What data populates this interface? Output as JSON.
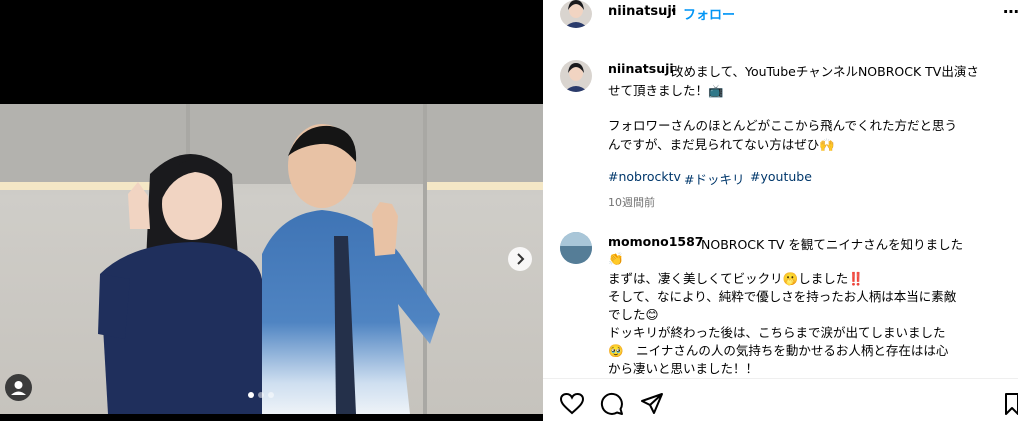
{
  "post": {
    "username": "niinatsuji",
    "separator": "•",
    "follow_label": "フォロー",
    "more_label": "⋯"
  },
  "caption": {
    "username": "niinatsuji",
    "line1": "改めまして、YouTubeチャンネルNOBROCK TV出演さ",
    "line2": "せて頂きました！📺",
    "line3": "フォロワーさんのほとんどがここから飛んでくれた方だと思う",
    "line4": "んですが、まだ見られてない方はぜひ🙌",
    "hashtags": [
      "#nobrocktv",
      "#ドッキリ",
      "#youtube"
    ],
    "time": "10週間前"
  },
  "comment": {
    "username": "momono1587",
    "line1": "NOBROCK TV を観てニイナさんを知りました",
    "line2": "👏",
    "line3": "まずは、凄く美しくてビックリ🫢しました‼️",
    "line4": "そして、なにより、純粋で優しさを持ったお人柄は本当に素敵",
    "line5": "でした😊",
    "line6": "ドッキリが終わった後は、こちらまで涙が出てしまいました",
    "line7": "🥹　ニイナさんの人の気持ちを動かせるお人柄と存在はは心",
    "line8": "から凄いと思いました！！"
  },
  "carousel": {
    "current": 1,
    "total": 4,
    "next_icon": "chevron-right-icon"
  },
  "actions": [
    "heart-icon",
    "comment-icon",
    "share-icon",
    "bookmark-icon"
  ],
  "colors": {
    "link": "#0095f6",
    "hashtag": "#00376b",
    "muted": "#737373",
    "sweater_navy": "#1f2f5c",
    "shirt_blue": "#3f74b5"
  }
}
